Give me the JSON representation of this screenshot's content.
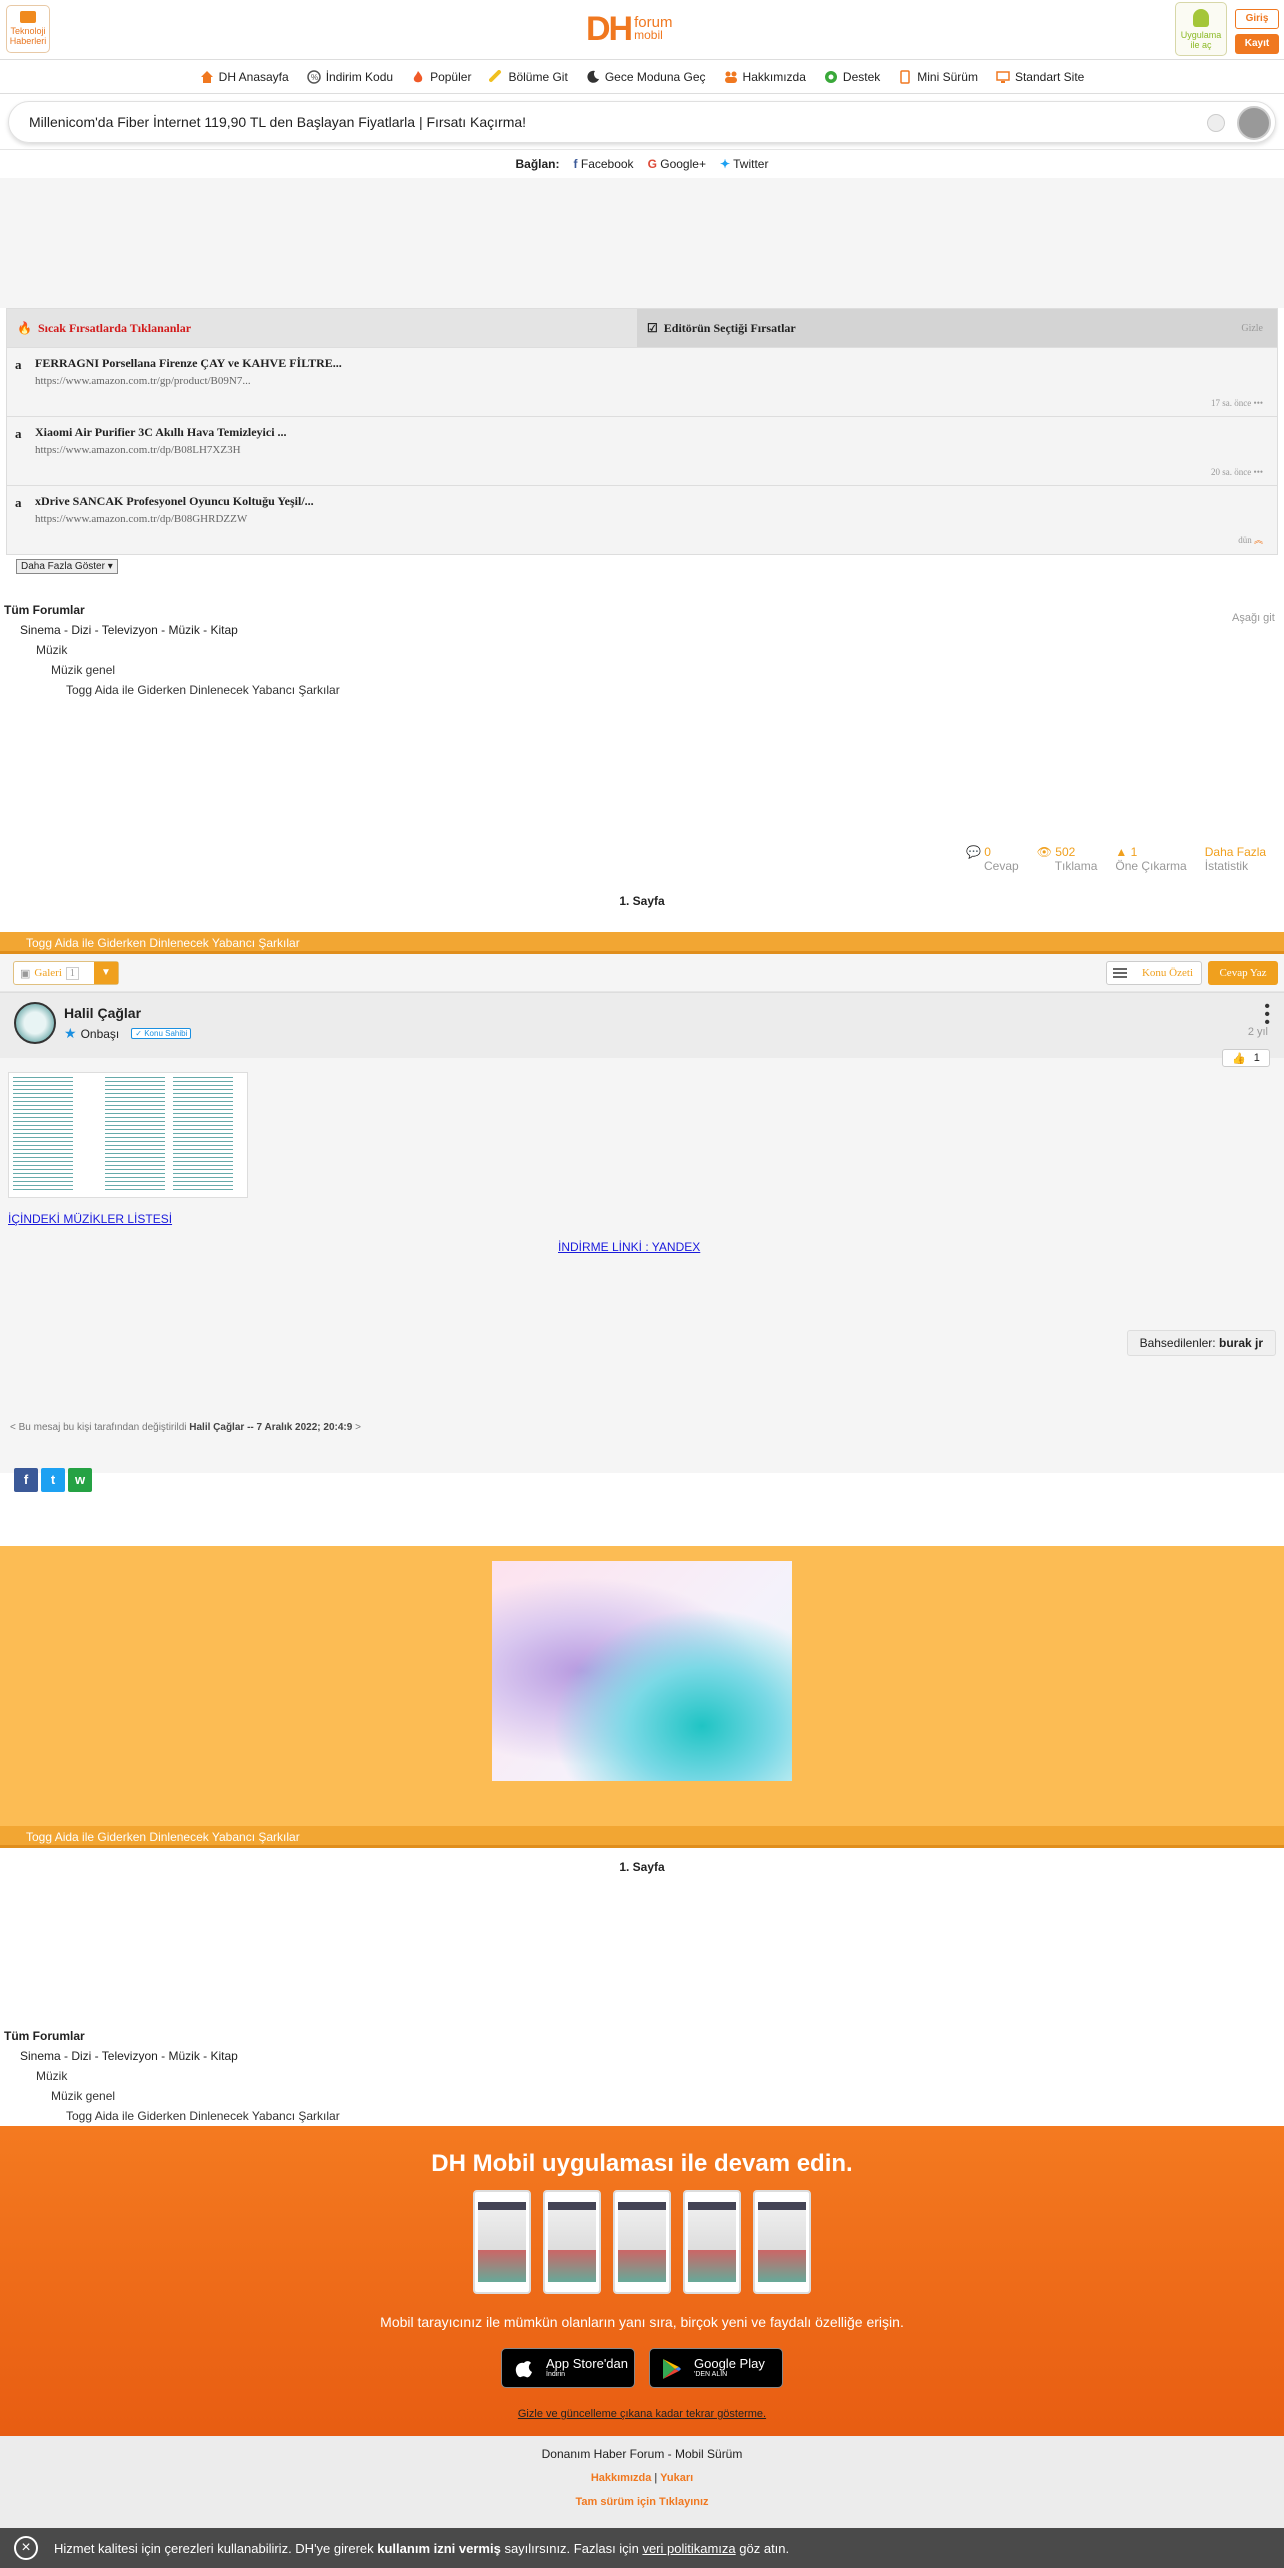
{
  "header": {
    "tech_label_1": "Teknoloji",
    "tech_label_2": "Haberleri",
    "logo_dh": "DH",
    "logo_forum": "forum",
    "logo_mobil": "mobil",
    "app_label_1": "Uygulama",
    "app_label_2": "ile aç",
    "login": "Giriş",
    "register": "Kayıt"
  },
  "nav": {
    "items": [
      {
        "label": "DH Anasayfa",
        "icon": "home-icon",
        "color": "#f07820"
      },
      {
        "label": "İndirim Kodu",
        "icon": "coupon-icon",
        "color": "#555555"
      },
      {
        "label": "Popüler",
        "icon": "flame-icon",
        "color": "#f05a28"
      },
      {
        "label": "Bölüme Git",
        "icon": "link-icon",
        "color": "#f0c020"
      },
      {
        "label": "Gece Moduna Geç",
        "icon": "moon-icon",
        "color": "#333333"
      },
      {
        "label": "Hakkımızda",
        "icon": "people-icon",
        "color": "#f07820"
      },
      {
        "label": "Destek",
        "icon": "support-icon",
        "color": "#3aa83a"
      },
      {
        "label": "Mini Sürüm",
        "icon": "mobile-icon",
        "color": "#f07820"
      },
      {
        "label": "Standart Site",
        "icon": "desktop-icon",
        "color": "#f07820"
      }
    ]
  },
  "search": {
    "text": "Millenicom'da Fiber İnternet 119,90 TL den Başlayan Fiyatlarla | Fırsatı Kaçırma!"
  },
  "connect": {
    "label": "Bağlan:",
    "facebook": "Facebook",
    "google": "Google+",
    "twitter": "Twitter"
  },
  "deals": {
    "hot_tab": "Sıcak Fırsatlarda Tıklananlar",
    "editor_tab": "Editörün Seçtiği Fırsatlar",
    "hide": "Gizle",
    "items": [
      {
        "title": "FERRAGNI Porsellana Firenze ÇAY ve KAHVE FİLTRE...",
        "url": "https://www.amazon.com.tr/gp/product/B09N7...",
        "time": "17 sa. önce"
      },
      {
        "title": "Xiaomi Air Purifier 3C Akıllı Hava Temizleyici ...",
        "url": "https://www.amazon.com.tr/dp/B08LH7XZ3H",
        "time": "20 sa. önce"
      },
      {
        "title": "xDrive SANCAK Profesyonel Oyuncu Koltuğu Yeşil/...",
        "url": "https://www.amazon.com.tr/dp/B08GHRDZZW",
        "time": "dün"
      }
    ],
    "more": "Daha Fazla Göster"
  },
  "breadcrumb": {
    "l0": "Tüm Forumlar",
    "l1": "Sinema - Dizi - Televizyon - Müzik - Kitap",
    "l2": "Müzik",
    "l3": "Müzik genel",
    "l4": "Togg Aida ile Giderken Dinlenecek Yabancı Şarkılar",
    "down": "Aşağı git"
  },
  "stats": {
    "replies": "0",
    "replies_label": "Cevap",
    "clicks": "502",
    "clicks_label": "Tıklama",
    "promote": "1",
    "promote_label": "Öne Çıkarma",
    "more": "Daha Fazla",
    "more_label": "İstatistik"
  },
  "page": {
    "label": "1. Sayfa",
    "title": "Togg Aida ile Giderken Dinlenecek Yabancı Şarkılar"
  },
  "toolbar": {
    "gallery": "Galeri",
    "gallery_count": "1",
    "konu_ozeti": "Konu Özeti",
    "reply": "Cevap Yaz"
  },
  "post": {
    "user": "Halil Çağlar",
    "rank": "Onbaşı",
    "owner_badge": "Konu Sahibi",
    "ago": "2 yıl",
    "likes": "1",
    "link1": "İÇİNDEKİ MÜZİKLER LİSTESİ",
    "link2": "İNDİRME LİNKİ : YANDEX",
    "mention_label": "Bahsedilenler:",
    "mention_user": "burak jr",
    "edited_pre": "< Bu mesaj bu kişi tarafından değiştirildi",
    "edited_user": "Halil Çağlar",
    "edited_date": "-- 7 Aralık 2022; 20:4:9",
    "edited_post": ">"
  },
  "app_promo": {
    "title": "DH Mobil uygulaması ile devam edin.",
    "desc": "Mobil tarayıcınız ile mümkün olanların yanı sıra, birçok yeni ve faydalı özelliğe erişin.",
    "appstore_1": "App Store'dan",
    "appstore_2": "İndirin",
    "gplay_1": "Google Play",
    "gplay_2": "'DEN ALIN",
    "hide": "Gizle ve güncelleme çıkana kadar tekrar gösterme."
  },
  "footer": {
    "line1": "Donanım Haber Forum - Mobil Sürüm",
    "about": "Hakkımızda",
    "sep": "|",
    "up": "Yukarı",
    "full": "Tam sürüm için Tıklayınız"
  },
  "cookie": {
    "pre": "Hizmet kalitesi için çerezleri kullanabiliriz. DH'ye girerek",
    "bold": "kullanım izni vermiş",
    "mid": "sayılırsınız. Fazlası için",
    "link": "veri politikamıza",
    "post": "göz atın."
  }
}
